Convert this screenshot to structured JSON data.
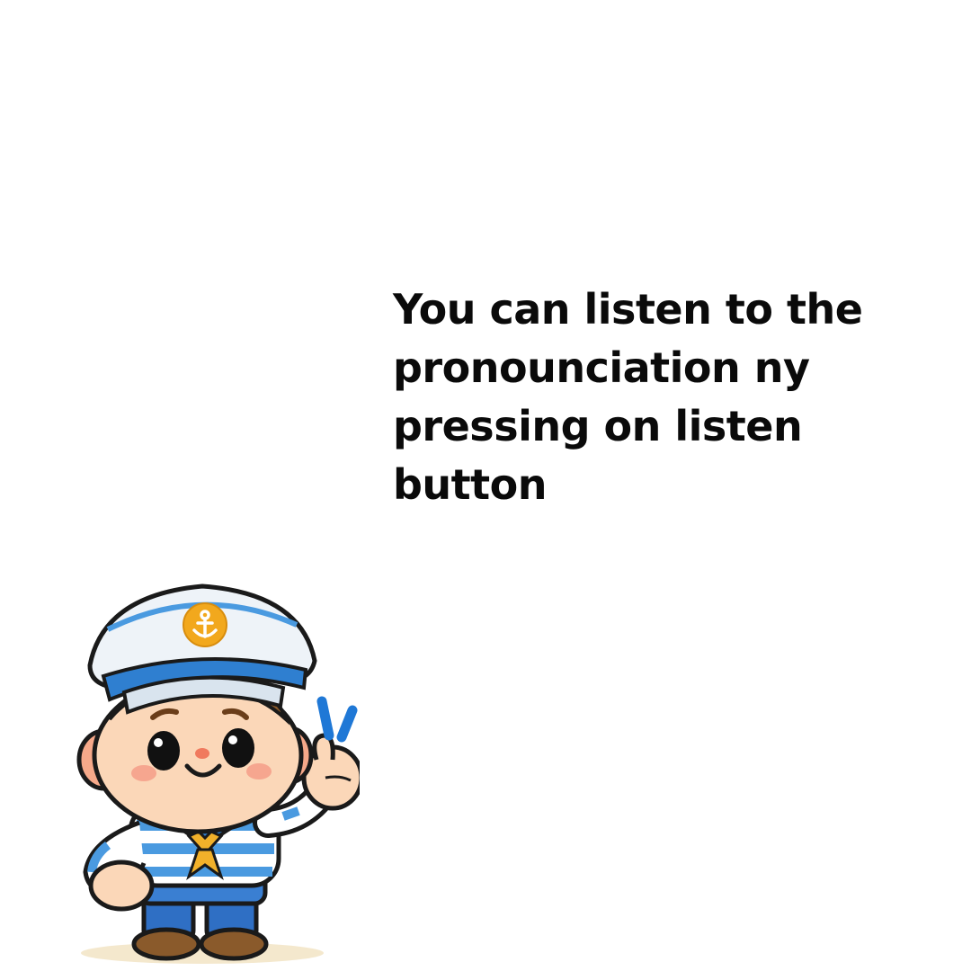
{
  "tutorial": {
    "message": "You can listen to the pronounciation ny pressing on listen button",
    "mascot_icon": "sailor-mascot-icon"
  },
  "colors": {
    "background": "#ffffff",
    "text": "#0a0a0a",
    "mascot_blue": "#2f7fd0",
    "mascot_gold": "#f2a81d"
  }
}
